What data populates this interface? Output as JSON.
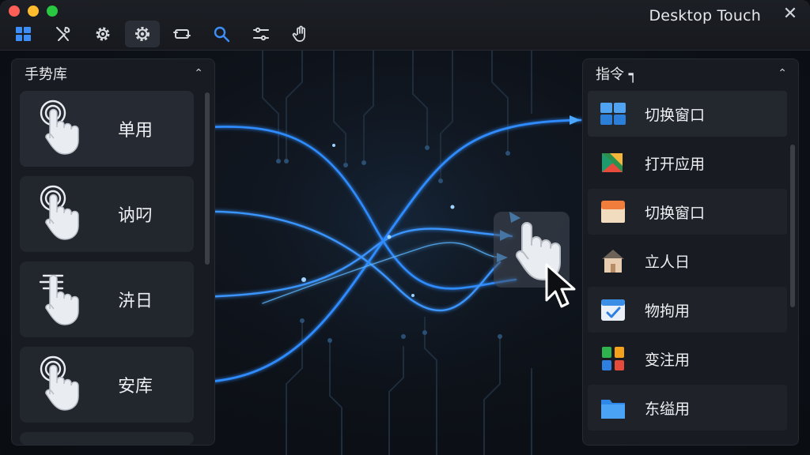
{
  "window": {
    "title": "Desktop Touch",
    "close_glyph": "✕"
  },
  "toolbar": [
    {
      "name": "apps-grid-icon"
    },
    {
      "name": "tools-icon"
    },
    {
      "name": "settings-gear-icon"
    },
    {
      "name": "settings-gear-active-icon"
    },
    {
      "name": "switch-window-icon"
    },
    {
      "name": "search-icon"
    },
    {
      "name": "sliders-icon"
    },
    {
      "name": "hand-icon"
    }
  ],
  "left_panel": {
    "title": "手势库",
    "collapse_glyph": "⌃",
    "gestures": [
      {
        "label": "单用",
        "icon": "tap-gesture-icon"
      },
      {
        "label": "讷叼",
        "icon": "tap-gesture-icon"
      },
      {
        "label": "泋日",
        "icon": "swipe-gesture-icon"
      },
      {
        "label": "安库",
        "icon": "tap-gesture-icon"
      }
    ]
  },
  "right_panel": {
    "title": "指令 ┑",
    "collapse_glyph": "⌃",
    "commands": [
      {
        "label": "切换窗口",
        "icon": "windows-tiles-icon"
      },
      {
        "label": "打开应用",
        "icon": "app-launcher-icon"
      },
      {
        "label": "切换窗口",
        "icon": "window-switch-icon"
      },
      {
        "label": "立人日",
        "icon": "house-icon"
      },
      {
        "label": "物拘用",
        "icon": "calendar-check-icon"
      },
      {
        "label": "变注用",
        "icon": "colored-grid-icon"
      },
      {
        "label": "东缢用",
        "icon": "folder-icon"
      }
    ]
  },
  "colors": {
    "accent": "#2f8cff",
    "glow": "#5ab4ff",
    "panel": "#181b21",
    "card": "#22262d"
  }
}
